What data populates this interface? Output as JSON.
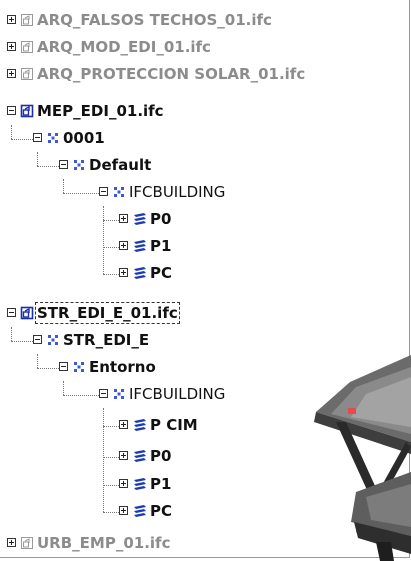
{
  "tree": {
    "items": [
      {
        "label": "ARQ_FALSOS TECHOS_01.ifc",
        "icon": "file-icon",
        "expanded": false,
        "style": "gray"
      },
      {
        "label": "ARQ_MOD_EDI_01.ifc",
        "icon": "file-icon",
        "expanded": false,
        "style": "gray"
      },
      {
        "label": "ARQ_PROTECCION SOLAR_01.ifc",
        "icon": "file-icon",
        "expanded": false,
        "style": "gray"
      },
      {
        "label": "MEP_EDI_01.ifc",
        "icon": "file-icon",
        "expanded": true,
        "style": "bold"
      },
      {
        "label": "0001",
        "icon": "project-icon",
        "expanded": true,
        "style": "bold"
      },
      {
        "label": "Default",
        "icon": "site-icon",
        "expanded": true,
        "style": "bold"
      },
      {
        "label": "IFCBUILDING",
        "icon": "building-icon",
        "expanded": true,
        "style": "normal"
      },
      {
        "label": "P0",
        "icon": "storey-icon",
        "expanded": false,
        "style": "bold"
      },
      {
        "label": "P1",
        "icon": "storey-icon",
        "expanded": false,
        "style": "bold"
      },
      {
        "label": "PC",
        "icon": "storey-icon",
        "expanded": false,
        "style": "bold"
      },
      {
        "label": "STR_EDI_E_01.ifc",
        "icon": "file-icon",
        "expanded": true,
        "style": "bold",
        "selected": true
      },
      {
        "label": "STR_EDI_E",
        "icon": "project-icon",
        "expanded": true,
        "style": "bold"
      },
      {
        "label": "Entorno",
        "icon": "site-icon",
        "expanded": true,
        "style": "bold"
      },
      {
        "label": "IFCBUILDING",
        "icon": "building-icon",
        "expanded": true,
        "style": "normal"
      },
      {
        "label": "P CIM",
        "icon": "storey-icon",
        "expanded": false,
        "style": "bold"
      },
      {
        "label": "P0",
        "icon": "storey-icon",
        "expanded": false,
        "style": "bold"
      },
      {
        "label": "P1",
        "icon": "storey-icon",
        "expanded": false,
        "style": "bold"
      },
      {
        "label": "PC",
        "icon": "storey-icon",
        "expanded": false,
        "style": "bold"
      },
      {
        "label": "URB_EMP_01.ifc",
        "icon": "file-icon",
        "expanded": false,
        "style": "gray"
      }
    ]
  },
  "colors": {
    "file_active": "#1a2fa8",
    "file_inactive": "#9a9a9a",
    "node_blue": "#3a5ad8",
    "storey_blue": "#1d3bb3",
    "label_gray": "#8c8c8c"
  }
}
